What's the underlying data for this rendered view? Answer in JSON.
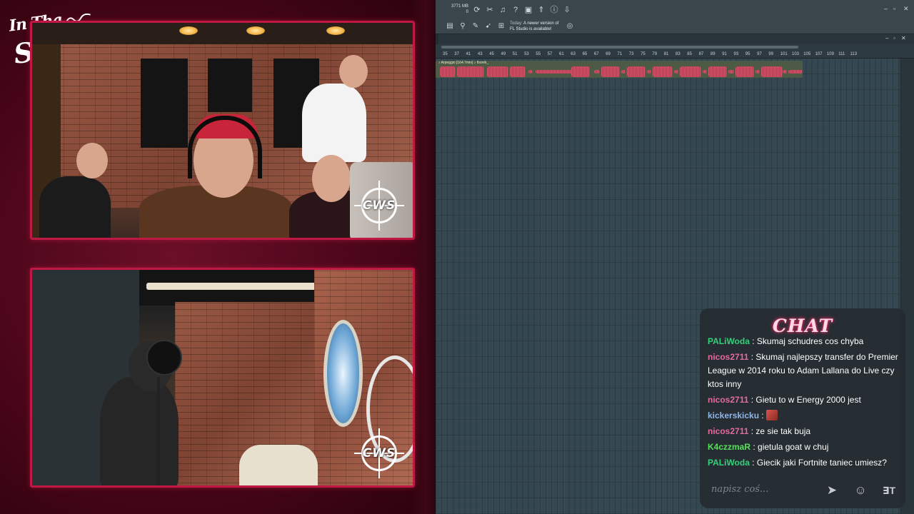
{
  "overlay": {
    "logo_line1": "In Tha",
    "logo_line2": "Studio!",
    "watermark": "CWS",
    "colors": {
      "frame": "#c01845",
      "background": "#4a0619"
    }
  },
  "daw": {
    "memory_label": "3771 MB",
    "memory_value": "0",
    "notice": {
      "today": "Today:",
      "line1": "A newer version of",
      "line2": "FL Studio is available!"
    },
    "toolbar_icons": [
      "refresh-icon",
      "cut-icon",
      "mic-icon",
      "help-icon",
      "save-icon",
      "rocket-icon",
      "info-icon",
      "download-icon"
    ],
    "window_controls": [
      "–",
      "▫",
      "✕"
    ],
    "clip_title": "♪ Arpeggio [164.7min] ♪ Iborek_",
    "ruler_ticks": [
      "35",
      "37",
      "41",
      "43",
      "45",
      "49",
      "51",
      "53",
      "55",
      "57",
      "61",
      "63",
      "65",
      "67",
      "69",
      "71",
      "73",
      "75",
      "79",
      "81",
      "83",
      "85",
      "87",
      "89",
      "91",
      "93",
      "95",
      "97",
      "99",
      "101",
      "103",
      "105",
      "107",
      "109",
      "111",
      "113"
    ]
  },
  "chat": {
    "title": "CHAT",
    "messages": [
      {
        "user": "PALiWoda",
        "color": "#33d17a",
        "text": "Skumaj schudres cos chyba"
      },
      {
        "user": "nicos2711",
        "color": "#e46aa0",
        "text": "Skumaj najlepszy transfer do Premier League w 2014 roku to Adam Lallana do Live czy ktos inny"
      },
      {
        "user": "nicos2711",
        "color": "#e46aa0",
        "text": "Gietu to w Energy 2000 jest"
      },
      {
        "user": "kickerskicku",
        "color": "#8fb6e8",
        "text": ""
      },
      {
        "user": "nicos2711",
        "color": "#e46aa0",
        "text": "ze sie tak buja"
      },
      {
        "user": "K4czzmaR",
        "color": "#58e05a",
        "text": "gietula goat w chuj"
      },
      {
        "user": "PALiWoda",
        "color": "#33d17a",
        "text": "Giecik jaki Fortnite taniec umiesz?"
      }
    ],
    "input_placeholder": "napisz coś...",
    "separator": ":"
  }
}
